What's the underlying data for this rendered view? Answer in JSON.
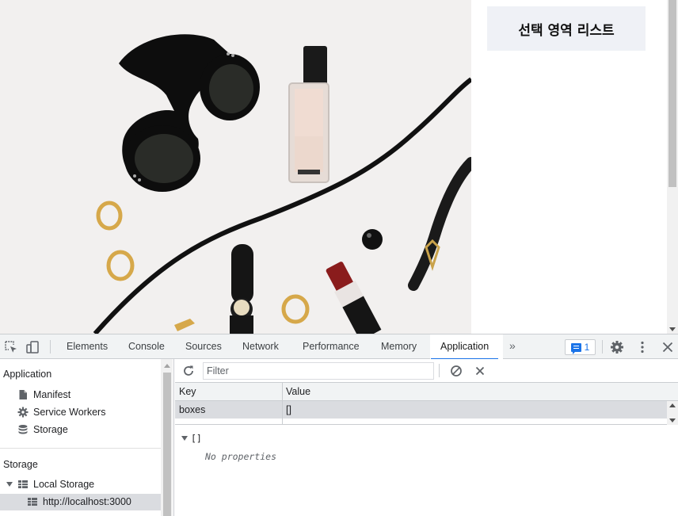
{
  "page": {
    "panel_title": "선택 영역 리스트"
  },
  "devtools": {
    "tabs": [
      {
        "label": "Elements"
      },
      {
        "label": "Console"
      },
      {
        "label": "Sources"
      },
      {
        "label": "Network"
      },
      {
        "label": "Performance"
      },
      {
        "label": "Memory"
      },
      {
        "label": "Application",
        "active": true
      }
    ],
    "more_tabs_glyph": "»",
    "issues_count": "1",
    "sidebar": {
      "application_heading": "Application",
      "application_items": [
        {
          "label": "Manifest",
          "icon": "file-icon"
        },
        {
          "label": "Service Workers",
          "icon": "gear-icon"
        },
        {
          "label": "Storage",
          "icon": "database-icon"
        }
      ],
      "storage_heading": "Storage",
      "local_storage_label": "Local Storage",
      "local_storage_origin": "http://localhost:3000"
    },
    "filter": {
      "placeholder": "Filter"
    },
    "table": {
      "headers": [
        "Key",
        "Value"
      ],
      "rows": [
        {
          "key": "boxes",
          "value": "[]"
        }
      ]
    },
    "preview": {
      "root": "[]",
      "empty_text": "No properties"
    },
    "colors": {
      "accent": "#1a73e8",
      "selected_row": "#dadce0",
      "panel_box": "#eff1f6"
    }
  }
}
